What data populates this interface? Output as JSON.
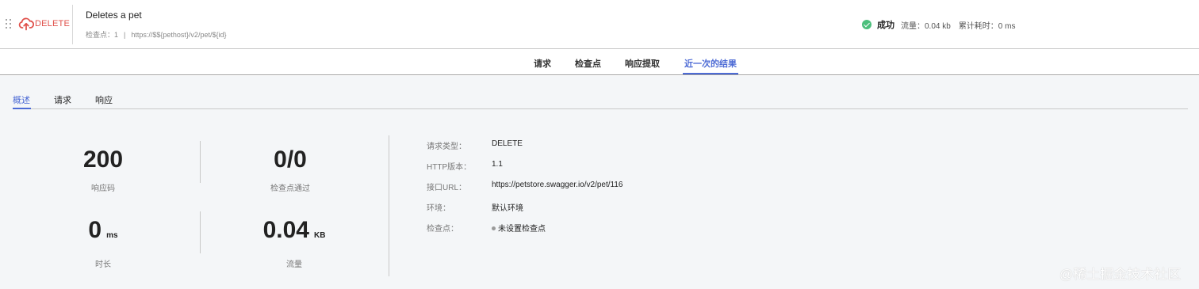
{
  "header": {
    "method": "DELETE",
    "title": "Deletes a pet",
    "checkpoint_label": "检查点：",
    "checkpoint_count": "1",
    "separator": "|",
    "url": "https://$${pethost}/v2/pet/${id}",
    "status": "成功",
    "flow": "流量：0.04 kb",
    "elapsed": "累计耗时：0 ms"
  },
  "main_tabs": [
    {
      "label": "请求"
    },
    {
      "label": "检查点"
    },
    {
      "label": "响应提取"
    },
    {
      "label": "近一次的结果"
    }
  ],
  "sub_tabs": [
    {
      "label": "概述"
    },
    {
      "label": "请求"
    },
    {
      "label": "响应"
    }
  ],
  "metrics": {
    "response_code": {
      "value": "200",
      "label": "响应码"
    },
    "checkpoints_passed": {
      "value": "0/0",
      "label": "检查点通过"
    },
    "duration": {
      "value": "0",
      "unit": "ms",
      "label": "时长"
    },
    "traffic": {
      "value": "0.04",
      "unit": "KB",
      "label": "流量"
    }
  },
  "details": [
    {
      "label": "请求类型：",
      "value": "DELETE"
    },
    {
      "label": "HTTP版本：",
      "value": "1.1"
    },
    {
      "label": "接口URL：",
      "value": "https://petstore.swagger.io/v2/pet/116"
    },
    {
      "label": "环境：",
      "value": "默认环境"
    },
    {
      "label": "检查点：",
      "value": "未设置检查点"
    }
  ],
  "watermark": "@稀土掘金技术社区",
  "colors": {
    "accent": "#4d6bd5",
    "method_delete": "#e0514b",
    "success": "#4cbf7c",
    "content_bg": "#f4f6f8"
  }
}
